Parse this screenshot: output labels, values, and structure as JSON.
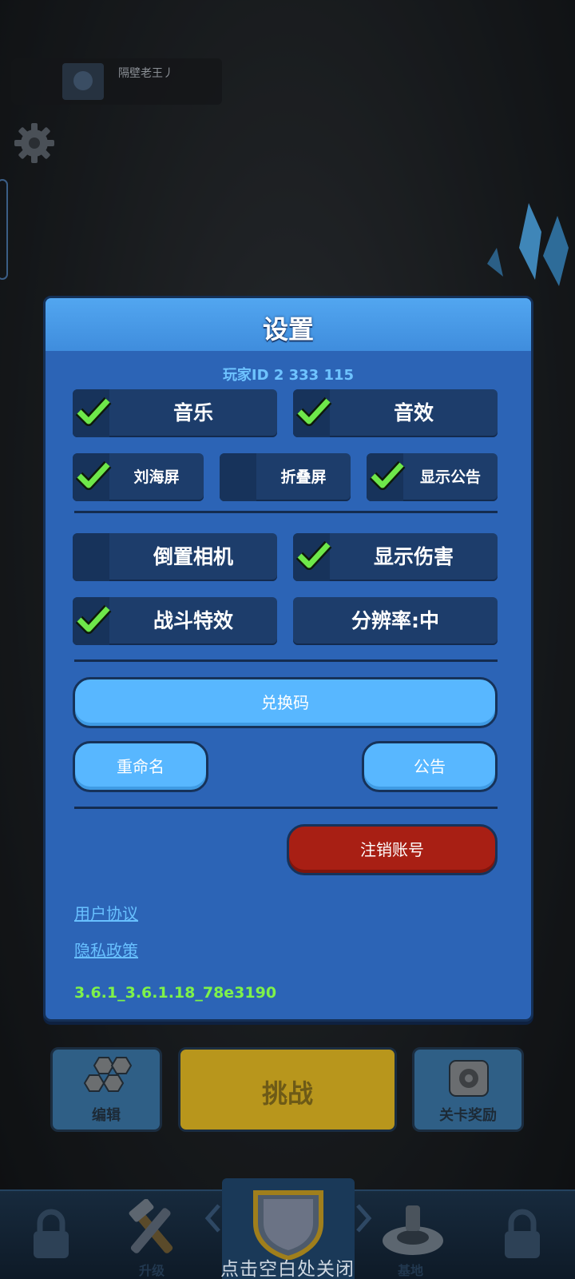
{
  "background": {
    "player_name": "隔壁老王丿",
    "challenge_label": "挑战",
    "edit_label": "编辑",
    "reward_label": "关卡奖励",
    "upgrade_label": "升级",
    "base_label": "基地"
  },
  "dialog": {
    "title": "设置",
    "player_id": "玩家ID 2 333 115",
    "toggles": [
      {
        "label": "音乐",
        "checked": true
      },
      {
        "label": "音效",
        "checked": true
      },
      {
        "label": "刘海屏",
        "checked": true
      },
      {
        "label": "折叠屏",
        "checked": false
      },
      {
        "label": "显示公告",
        "checked": true
      },
      {
        "label": "倒置相机",
        "checked": false
      },
      {
        "label": "显示伤害",
        "checked": true
      },
      {
        "label": "战斗特效",
        "checked": true
      }
    ],
    "resolution_label": "分辨率:中",
    "redeem_label": "兑换码",
    "rename_label": "重命名",
    "notice_label": "公告",
    "delete_account_label": "注销账号",
    "user_agreement_label": "用户协议",
    "privacy_policy_label": "隐私政策",
    "version": "3.6.1_3.6.1.18_78e3190"
  },
  "close_hint": "点击空白处关闭",
  "colors": {
    "dialog_bg": "#2c64b6",
    "check_green": "#6ee84a",
    "danger_red": "#a81f14",
    "accent_blue": "#58b7ff",
    "version_green": "#7ef24a"
  }
}
